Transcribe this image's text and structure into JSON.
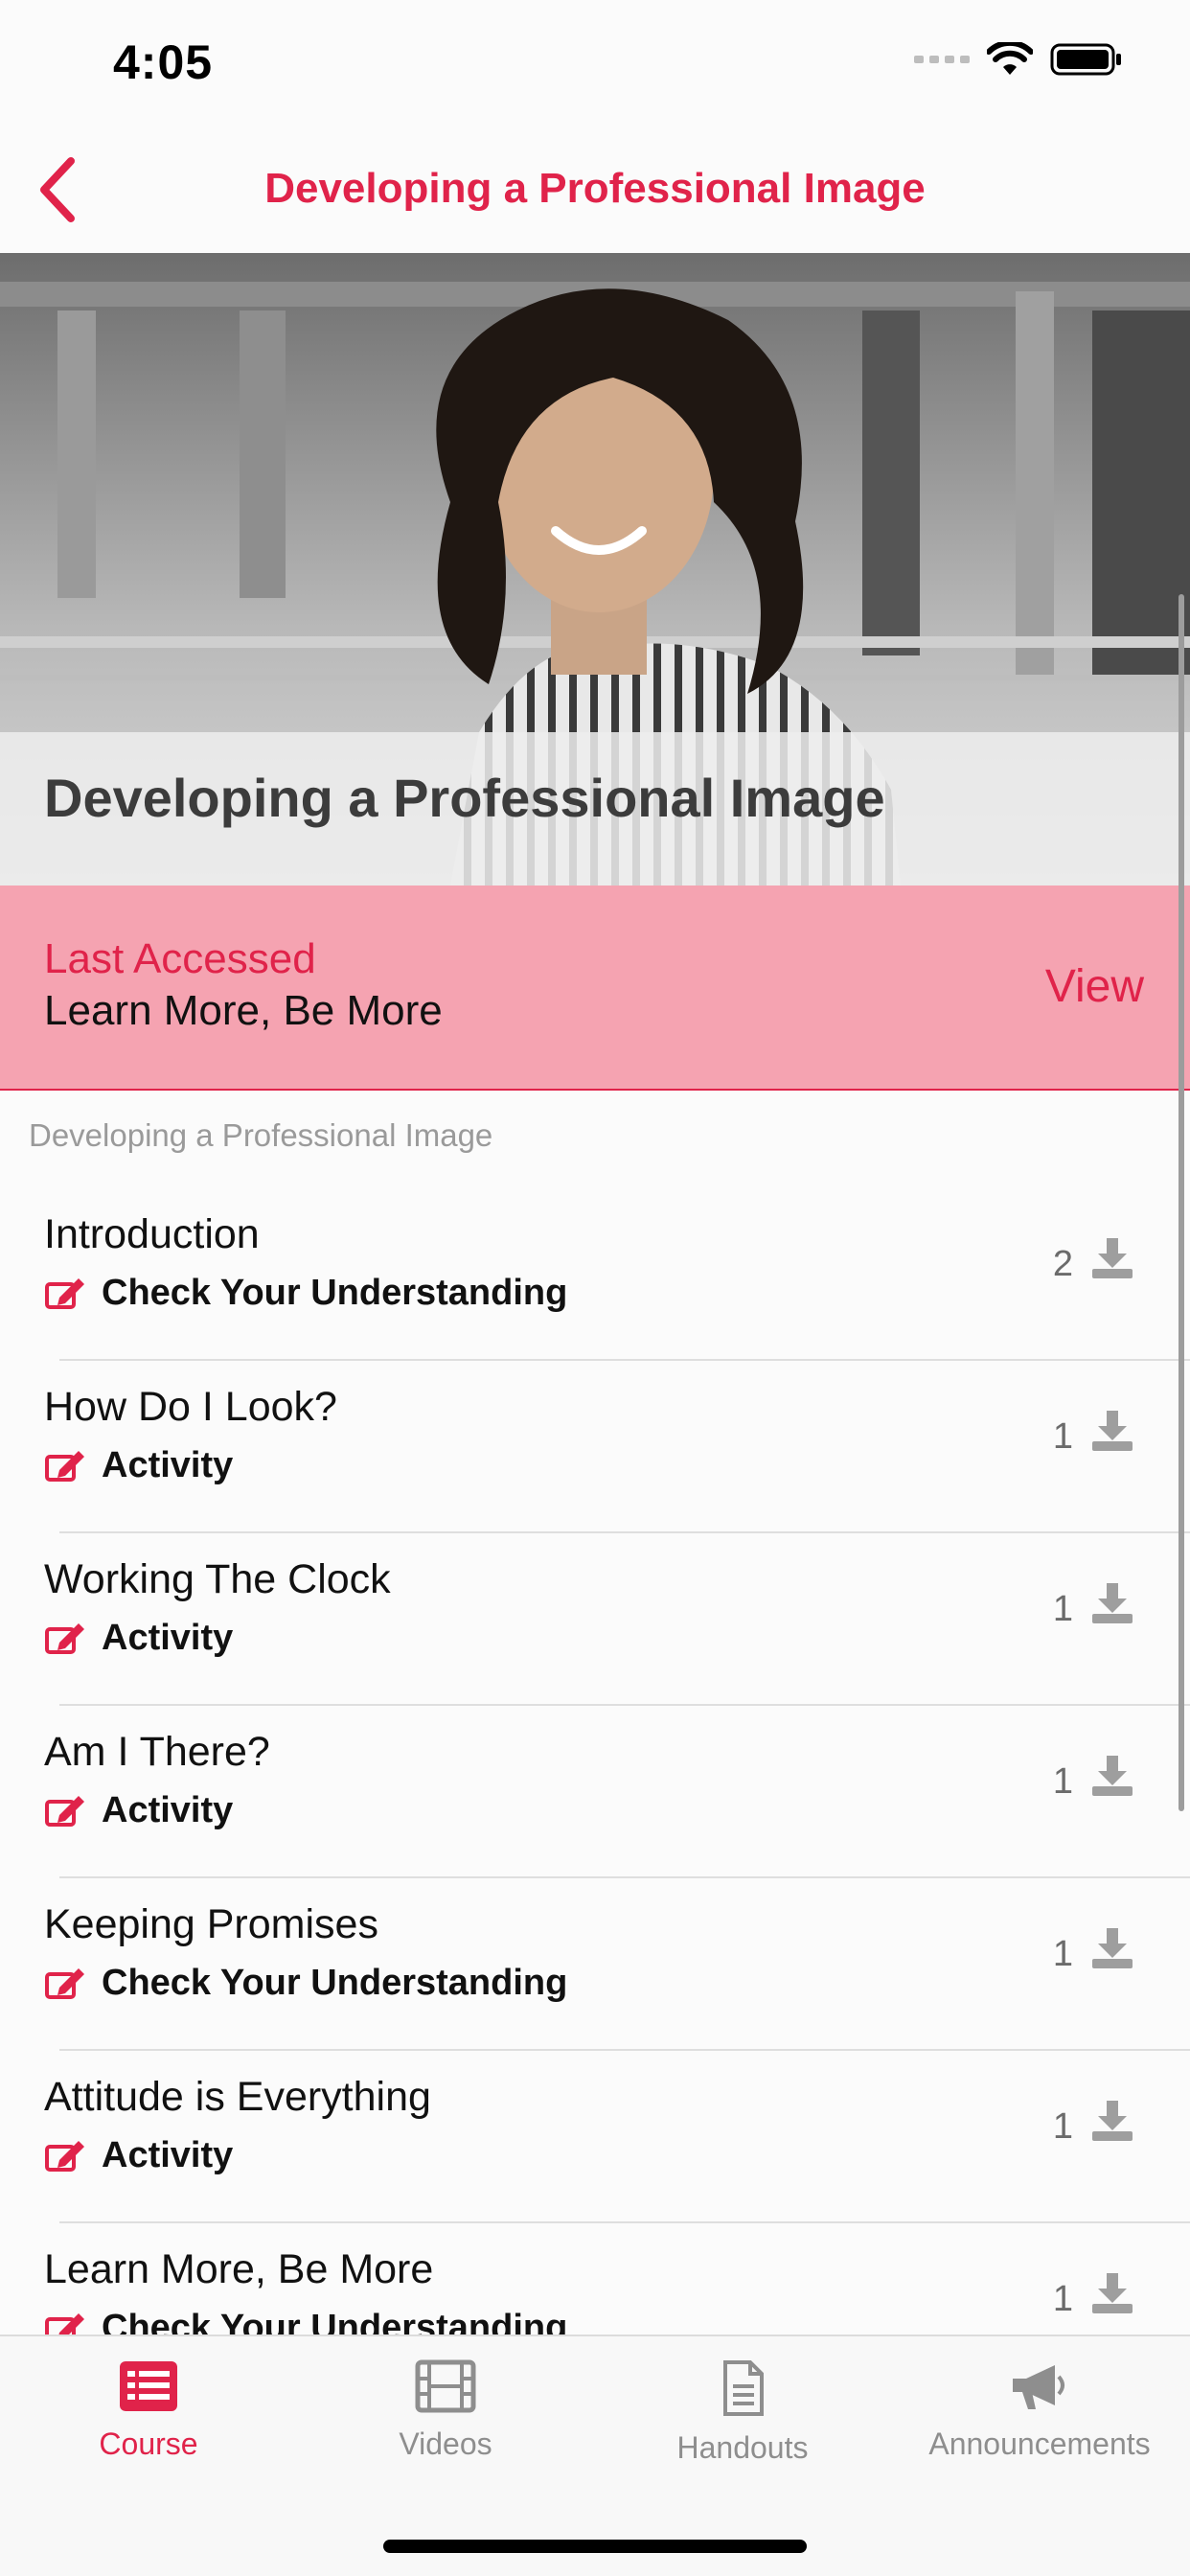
{
  "status_bar": {
    "time": "4:05"
  },
  "nav": {
    "title": "Developing a Professional Image"
  },
  "hero": {
    "title": "Developing a Professional Image"
  },
  "last_accessed": {
    "label": "Last Accessed",
    "value": "Learn More, Be More",
    "action": "View"
  },
  "section": {
    "title": "Developing a Professional Image"
  },
  "lessons": [
    {
      "title": "Introduction",
      "type": "Check Your Understanding",
      "count": "2"
    },
    {
      "title": "How Do I Look?",
      "type": "Activity",
      "count": "1"
    },
    {
      "title": "Working The Clock",
      "type": "Activity",
      "count": "1"
    },
    {
      "title": "Am I There?",
      "type": "Activity",
      "count": "1"
    },
    {
      "title": "Keeping Promises",
      "type": "Check Your Understanding",
      "count": "1"
    },
    {
      "title": "Attitude is Everything",
      "type": "Activity",
      "count": "1"
    },
    {
      "title": "Learn More, Be More",
      "type": "Check Your Understanding",
      "count": "1"
    }
  ],
  "tabs": [
    {
      "label": "Course",
      "icon": "list-icon",
      "active": true
    },
    {
      "label": "Videos",
      "icon": "film-icon",
      "active": false
    },
    {
      "label": "Handouts",
      "icon": "document-icon",
      "active": false
    },
    {
      "label": "Announcements",
      "icon": "megaphone-icon",
      "active": false
    }
  ],
  "colors": {
    "accent": "#e0234a",
    "banner": "#f5a3b1"
  }
}
